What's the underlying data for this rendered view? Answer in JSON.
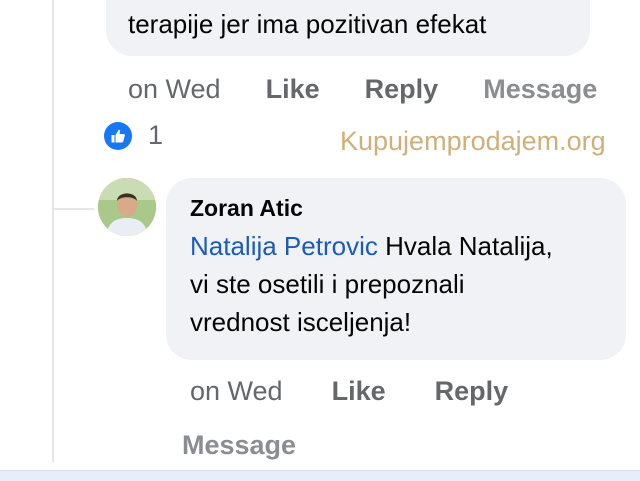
{
  "previous_comment": {
    "text_tail": "terapije jer ima pozitivan efekat",
    "actions": {
      "time": "on Wed",
      "like": "Like",
      "reply": "Reply",
      "message": "Message"
    },
    "reaction": {
      "icon": "like-icon",
      "color": "#1877f2",
      "count": "1"
    }
  },
  "watermark": "Kupujemprodajem.org",
  "reply_comment": {
    "avatar": "avatar",
    "author": "Zoran Atic",
    "mention": "Natalija Petrovic",
    "text_line1": " Hvala Natalija,",
    "text_line2": "vi ste osetili i prepoznali",
    "text_line3": "vrednost isceljenja!",
    "actions": {
      "time": "on Wed",
      "like": "Like",
      "reply": "Reply",
      "message": "Message"
    }
  }
}
